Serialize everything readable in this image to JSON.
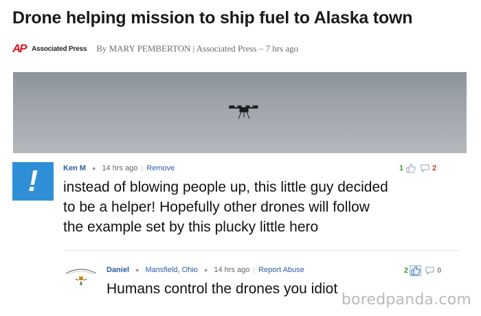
{
  "article": {
    "headline": "Drone helping mission to ship fuel to Alaska town",
    "source_logo_mark": "AP",
    "source_logo_text": "Associated Press",
    "byline": "By MARY PEMBERTON | Associated Press – 7 hrs ago"
  },
  "comments": [
    {
      "author": "Ken M",
      "time": "14 hrs ago",
      "action": "Remove",
      "text_lines": [
        "instead of blowing people up, this little guy decided",
        "to be a helper! Hopefully other drones will follow",
        "the example set by this plucky little hero"
      ],
      "thumbs_up": "1",
      "thumbs_down": "2",
      "avatar_icon": "yahoo-y-icon"
    },
    {
      "author": "Daniel",
      "location": "Mansfield, Ohio",
      "time": "14 hrs ago",
      "action": "Report Abuse",
      "text": "Humans control the drones you idiot",
      "thumbs_up": "2",
      "thumbs_down": "0",
      "avatar_icon": "vietnam-veteran-badge-icon"
    }
  ],
  "watermark": "boredpanda.com",
  "colors": {
    "link_blue": "#2c5aa8",
    "ap_red": "#d71920",
    "avatar_blue": "#2f8fd6",
    "vote_up_green": "#3a9a2f",
    "vote_down_red": "#c0392b"
  }
}
